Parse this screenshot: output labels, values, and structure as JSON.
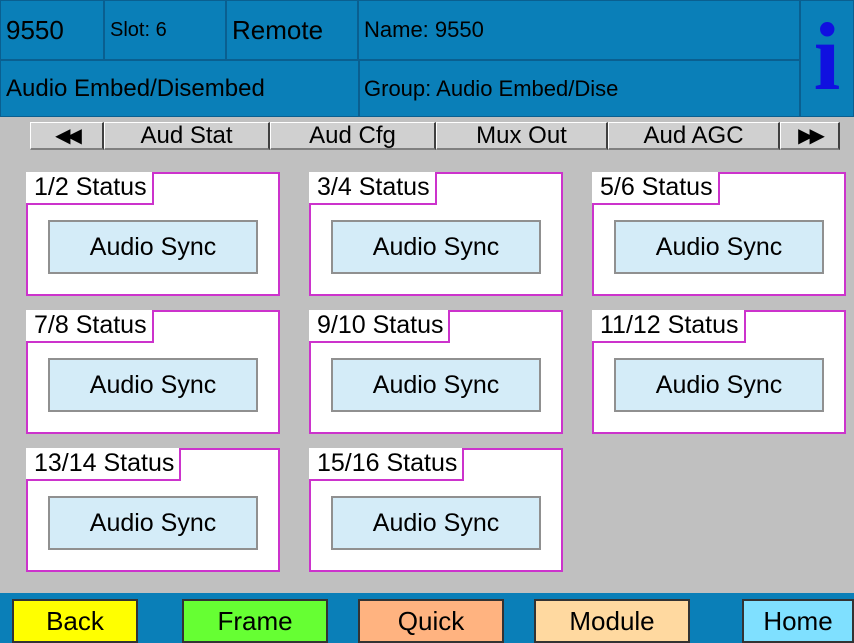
{
  "header": {
    "device": "9550",
    "slot": "Slot: 6",
    "mode": "Remote",
    "name": "Name: 9550",
    "module": "Audio Embed/Disembed",
    "group": "Group: Audio Embed/Dise",
    "info_icon": "i"
  },
  "tabs": {
    "prev_icon": "◀◀",
    "items": [
      "Aud Stat",
      "Aud Cfg",
      "Mux Out",
      "Aud AGC"
    ],
    "next_icon": "▶▶"
  },
  "panels": [
    {
      "title": "1/2 Status",
      "value": "Audio Sync"
    },
    {
      "title": "3/4 Status",
      "value": "Audio Sync"
    },
    {
      "title": "5/6 Status",
      "value": "Audio Sync"
    },
    {
      "title": "7/8 Status",
      "value": "Audio Sync"
    },
    {
      "title": "9/10 Status",
      "value": "Audio Sync"
    },
    {
      "title": "11/12 Status",
      "value": "Audio Sync"
    },
    {
      "title": "13/14 Status",
      "value": "Audio Sync"
    },
    {
      "title": "15/16 Status",
      "value": "Audio Sync"
    }
  ],
  "footer": {
    "back": "Back",
    "frame": "Frame",
    "quick": "Quick",
    "module": "Module",
    "home": "Home"
  },
  "colors": {
    "header_bg": "#0a7fb8",
    "panel_border": "#cc33cc",
    "value_bg": "#d4ecf8",
    "back": "#ffff00",
    "frame": "#66ff33",
    "quick": "#ffb380",
    "module": "#ffd9a0",
    "home": "#7fe0ff"
  }
}
